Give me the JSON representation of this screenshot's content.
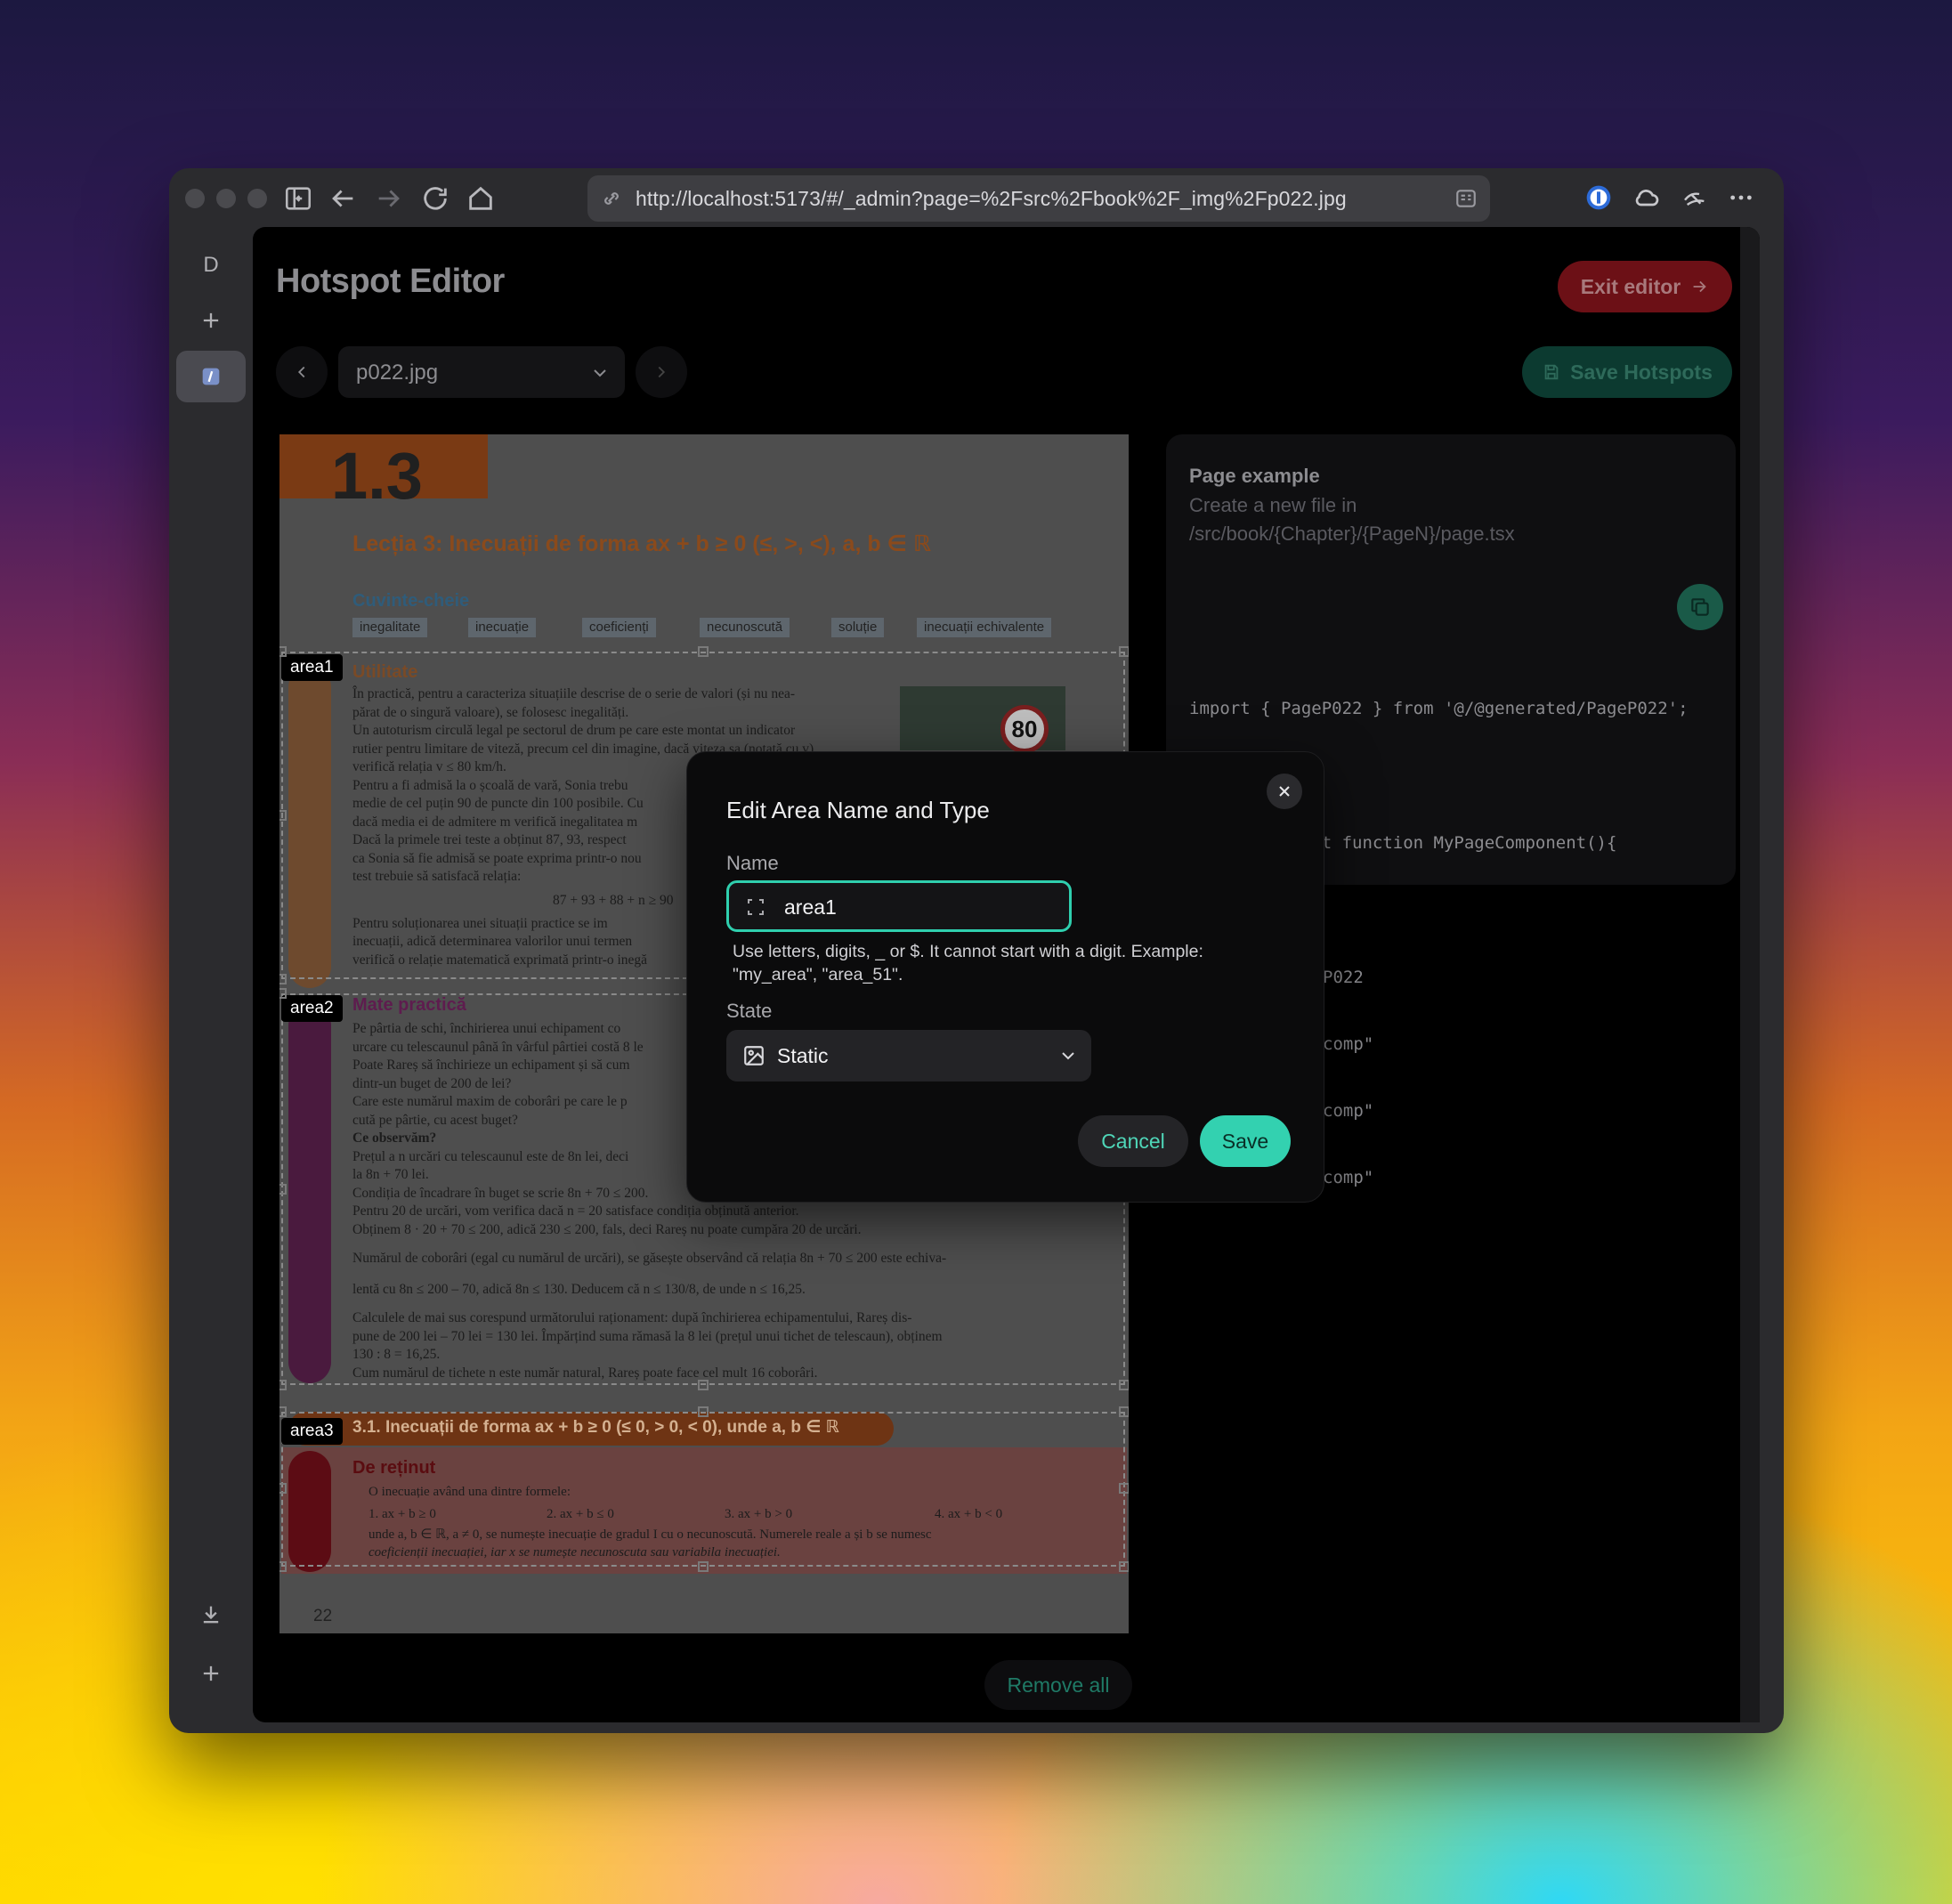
{
  "browser": {
    "url": "http://localhost:5173/#/_admin?page=%2Fsrc%2Fbook%2F_img%2Fp022.jpg",
    "sidebar_initial": "D"
  },
  "app": {
    "title": "Hotspot Editor",
    "exit_label": "Exit editor",
    "save_hotspots_label": "Save Hotspots",
    "page_select_value": "p022.jpg",
    "remove_all_label": "Remove all"
  },
  "book": {
    "chapter": "1.3",
    "lesson_title": "Lecția 3:  Inecuații de forma ax + b ≥ 0 (≤, >, <), a, b ∈ ℝ",
    "keywords_title": "Cuvinte-cheie",
    "keywords": [
      "inegalitate",
      "inecuație",
      "coeficienți",
      "necunoscută",
      "soluție",
      "inecuații echivalente"
    ],
    "sections": {
      "utilitate": "Utilitate",
      "mate": "Mate practică",
      "sub": "3.1. Inecuații de forma ax + b ≥ 0 (≤ 0, > 0, < 0), unde a, b ∈ ℝ",
      "retinut": "De reținut"
    },
    "sign_value": "80",
    "text_utilitate": [
      "În practică, pentru a caracteriza situațiile descrise de o serie de valori (și nu nea-",
      "părat de o singură valoare), se folosesc inegalități.",
      "Un autoturism circulă legal pe sectorul de drum pe care este montat un indicator",
      "rutier pentru limitare de viteză, precum cel din imagine, dacă viteza sa (notată cu v)",
      "verifică relația v ≤ 80 km/h.",
      "Pentru a fi admisă la o școală de vară, Sonia trebu",
      "medie de cel puțin 90 de puncte din 100 posibile. Cu",
      "dacă media ei de admitere m verifică inegalitatea m",
      "Dacă la primele trei teste a obținut 87, 93, respect",
      "ca Sonia să fie admisă se poate exprima printr-o nou",
      "test trebuie să satisfacă relația:",
      "87 + 93 + 88 + n ≥ 90",
      "Pentru soluționarea unei situații practice se im",
      "inecuații, adică determinarea valorilor unui termen",
      "verifică o relație matematică exprimată printr-o inegă"
    ],
    "text_mate": [
      "Pe pârtia de schi, închirierea unui echipament co",
      "urcare cu telescaunul până în vârful pârtiei costă 8 le",
      "Poate Rareș să închirieze un echipament și să cum",
      "dintr-un buget de 200 de lei?",
      "Care este numărul maxim de coborâri pe care le p",
      "cută pe pârtie, cu acest buget?",
      "Ce observăm?",
      "Prețul a n urcări cu telescaunul este de 8n lei, deci",
      "la 8n + 70 lei.",
      "Condiția de încadrare în buget se scrie 8n + 70 ≤ 200.",
      "Pentru 20 de urcări, vom verifica dacă n = 20 satisface condiția obținută anterior.",
      "Obținem 8 · 20 + 70 ≤ 200, adică 230 ≤ 200, fals, deci Rareș nu poate cumpăra 20 de urcări.",
      "Numărul de coborâri (egal cu numărul de urcări), se găsește observând că relația 8n + 70 ≤ 200 este echiva-",
      "lentă cu 8n ≤ 200 – 70, adică 8n ≤ 130. Deducem că n ≤ 130/8, de unde n ≤ 16,25.",
      "Calculele de mai sus corespund următorului raționament: după închirierea echipamentului, Rareș dis-",
      "pune de 200 lei – 70 lei = 130 lei. Împărțind suma rămasă la 8 lei (prețul unui tichet de telescaun), obținem",
      "130 : 8 = 16,25.",
      "Cum numărul de tichete n este număr natural, Rareș poate face cel mult 16 coborâri."
    ],
    "text_retinut": [
      "O inecuație având una dintre formele:",
      "1. ax + b ≥ 0",
      "2. ax + b ≤ 0",
      "3. ax + b > 0",
      "4. ax + b < 0",
      "unde a, b ∈ ℝ, a ≠ 0, se numește inecuație de gradul I cu o necunoscută. Numerele reale a și b se numesc",
      "coeficienții inecuației, iar x se numește necunoscuta sau variabila inecuației."
    ],
    "page_number": "22"
  },
  "areas": [
    "area1",
    "area2",
    "area3"
  ],
  "example": {
    "title": "Page example",
    "description": "Create a new file in /src/book/{Chapter}/{PageN}/page.tsx",
    "code_line1": "import { PageP022 } from '@/@generated/PageP022';",
    "code_line2": "export default function MyPageComponent(){",
    "code_line3": "P022",
    "code_line4": "comp\"",
    "code_line5": "comp\"",
    "code_line6": "comp\""
  },
  "modal": {
    "title": "Edit Area Name and Type",
    "name_label": "Name",
    "name_value": "area1",
    "help": "Use letters, digits, _ or $. It cannot start with a digit. Example: \"my_area\", \"area_51\".",
    "state_label": "State",
    "state_value": "Static",
    "cancel_label": "Cancel",
    "save_label": "Save"
  }
}
